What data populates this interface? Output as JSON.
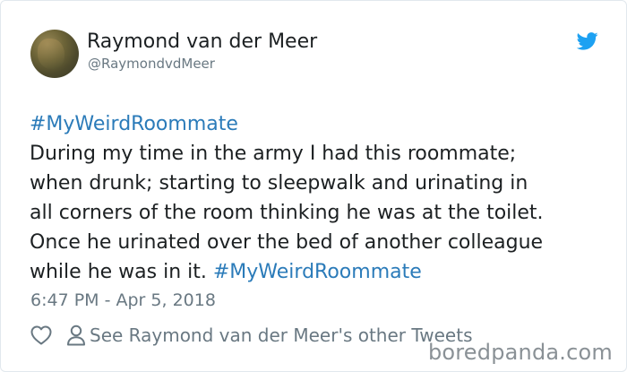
{
  "author": {
    "name": "Raymond van der Meer",
    "handle": "@RaymondvdMeer",
    "avatar_icon": "avatar-photo"
  },
  "brand": {
    "icon": "twitter-bird-icon",
    "color": "#1da1f2"
  },
  "tweet": {
    "hashtag_top": "#MyWeirdRoommate",
    "lines": [
      "During my time in the army I had this roommate;",
      "when drunk; starting to sleepwalk and urinating in",
      "all corners of the room thinking he was at the toilet.",
      "Once he urinated over the bed of another colleague"
    ],
    "last_line_text": "while he was in it. ",
    "hashtag_end": "#MyWeirdRoommate",
    "hashtag_color": "#2b7bb9"
  },
  "timestamp": "6:47 PM - Apr 5, 2018",
  "actions": {
    "like_icon": "heart-icon",
    "profile_icon": "person-icon",
    "other_tweets_label": "See Raymond van der Meer's other Tweets"
  },
  "watermark": "boredpanda.com"
}
